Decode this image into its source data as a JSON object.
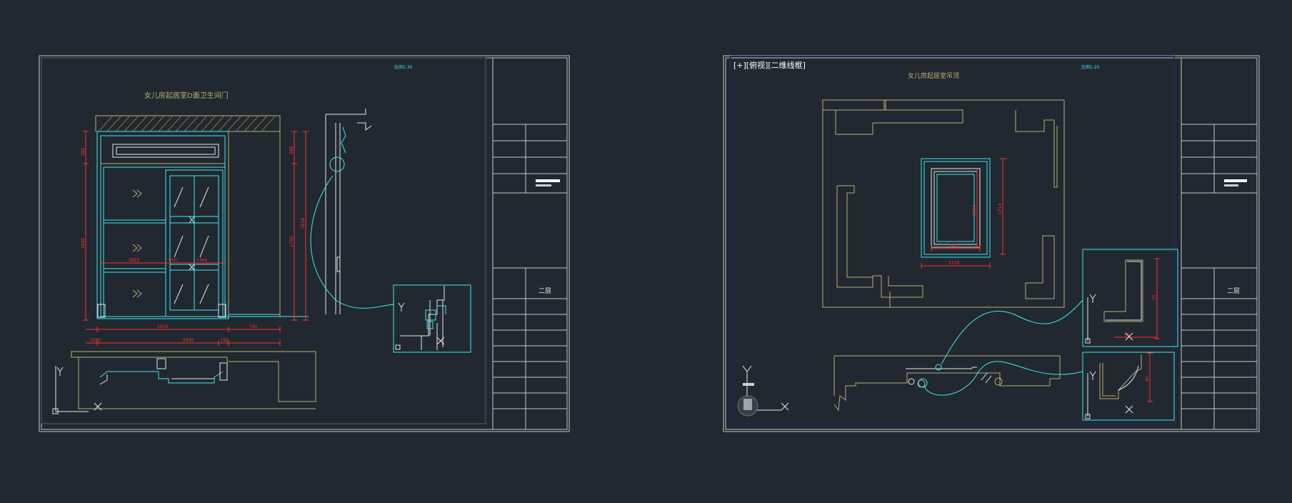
{
  "viewport": {
    "label": "[+][俯视][二维线框]"
  },
  "colors": {
    "background": "#212830",
    "frame": "#c8c8c8",
    "cyan": "#3fe8ee",
    "red": "#ff3030",
    "yellow": "#b7b070",
    "white": "#ffffff"
  },
  "left_sheet": {
    "title": "女儿房起居室D面卫生间门",
    "scale": "比例1:30",
    "level": "二层",
    "dims_horizontal": [
      "1650",
      "1620",
      "2430",
      "150",
      "741",
      "2920",
      "950",
      "1400"
    ],
    "dims_vertical": [
      "380",
      "2640",
      "380",
      "2740",
      "2650"
    ]
  },
  "right_sheet": {
    "title": "女儿房起居室吊顶",
    "scale": "比例1:25",
    "level": "二层",
    "dims_horizontal": [
      "800",
      "1150",
      "90"
    ],
    "dims_vertical": [
      "1550",
      "1714",
      "75",
      "40"
    ]
  },
  "ucs": {
    "y": "Y",
    "x": "X"
  }
}
